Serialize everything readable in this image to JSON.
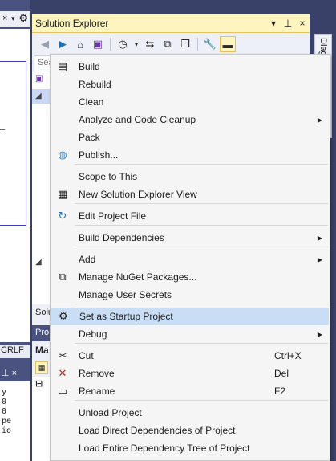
{
  "left": {
    "close_glyph": "×",
    "gear_glyph": "⚙",
    "status": "CRLF",
    "panel_close": "×",
    "code_lines": [
      "y",
      "0",
      "0",
      "pe",
      "io"
    ]
  },
  "solution_explorer": {
    "title": "Solution Explorer",
    "title_controls": [
      "▾",
      "⊥",
      "×"
    ],
    "search_placeholder": "Sea",
    "footer_tab": "Solu",
    "properties_title": "Pro",
    "properties_subject": "Ma"
  },
  "right_panel": {
    "tab_label": "Diagnosti"
  },
  "context_menu": {
    "items": [
      {
        "label": "Build",
        "icon": "build-icon",
        "glyph": "▤"
      },
      {
        "label": "Rebuild"
      },
      {
        "label": "Clean"
      },
      {
        "label": "Analyze and Code Cleanup",
        "submenu": true
      },
      {
        "label": "Pack"
      },
      {
        "label": "Publish...",
        "icon": "globe-icon",
        "glyph": "◍"
      },
      {
        "label": "Scope to This"
      },
      {
        "label": "New Solution Explorer View",
        "icon": "new-view-icon",
        "glyph": "▦"
      },
      {
        "label": "Edit Project File",
        "icon": "refresh-icon",
        "glyph": "↻"
      },
      {
        "label": "Build Dependencies",
        "submenu": true
      },
      {
        "label": "Add",
        "submenu": true
      },
      {
        "label": "Manage NuGet Packages...",
        "icon": "nuget-icon",
        "glyph": "⧉"
      },
      {
        "label": "Manage User Secrets"
      },
      {
        "label": "Set as Startup Project",
        "icon": "gear-icon",
        "glyph": "⚙",
        "highlighted": true
      },
      {
        "label": "Debug",
        "submenu": true
      },
      {
        "label": "Cut",
        "icon": "scissors-icon",
        "glyph": "✂",
        "shortcut": "Ctrl+X"
      },
      {
        "label": "Remove",
        "icon": "remove-icon",
        "glyph": "✕",
        "shortcut": "Del"
      },
      {
        "label": "Rename",
        "icon": "rename-icon",
        "glyph": "▭",
        "shortcut": "F2"
      },
      {
        "label": "Unload Project"
      },
      {
        "label": "Load Direct Dependencies of Project"
      },
      {
        "label": "Load Entire Dependency Tree of Project"
      }
    ],
    "colors": {
      "highlight": "#c9def5",
      "remove_icon": "#c8291c",
      "refresh_icon": "#1f6fb5",
      "globe_icon": "#3b86c6"
    }
  }
}
